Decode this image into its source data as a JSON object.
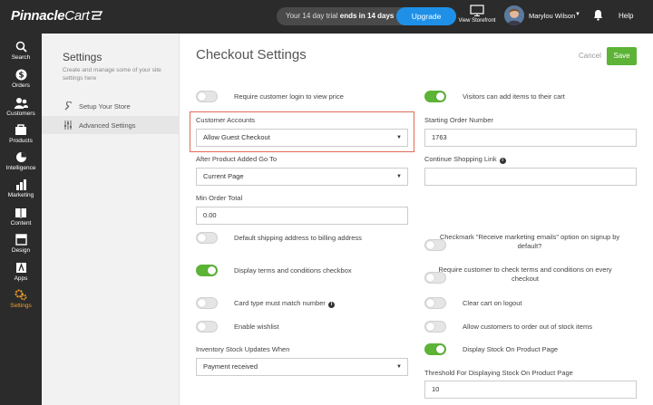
{
  "app": {
    "logo_main": "Pinnacle",
    "logo_cart": "Cart",
    "trial_prefix": "Your 14 day trial",
    "trial_bold": "ends in 14 days",
    "upgrade_label": "Upgrade",
    "storefront_label": "View Storefront",
    "user_name": "Marylou Wilson",
    "help_label": "Help"
  },
  "nav": [
    {
      "label": "Search",
      "icon": "search-icon"
    },
    {
      "label": "Orders",
      "icon": "dollar-icon"
    },
    {
      "label": "Customers",
      "icon": "users-icon"
    },
    {
      "label": "Products",
      "icon": "products-icon"
    },
    {
      "label": "Intelligence",
      "icon": "pie-chart-icon"
    },
    {
      "label": "Marketing",
      "icon": "bar-chart-icon"
    },
    {
      "label": "Content",
      "icon": "book-icon"
    },
    {
      "label": "Design",
      "icon": "design-icon"
    },
    {
      "label": "Apps",
      "icon": "apps-icon"
    },
    {
      "label": "Settings",
      "icon": "gear-icon",
      "active": true
    }
  ],
  "subpanel": {
    "title": "Settings",
    "description": "Create and manage some of your site settings here",
    "links": [
      "Setup Your Store",
      "Advanced Settings"
    ]
  },
  "page": {
    "title": "Checkout Settings",
    "cancel_label": "Cancel",
    "save_label": "Save"
  },
  "settings": {
    "require_login": {
      "label": "Require customer login to view price",
      "on": false
    },
    "visitors_add": {
      "label": "Visitors can add items to their cart",
      "on": true
    },
    "customer_accounts": {
      "label": "Customer Accounts",
      "value": "Allow Guest Checkout"
    },
    "starting_order": {
      "label": "Starting Order Number",
      "value": "1763"
    },
    "after_added": {
      "label": "After Product Added Go To",
      "value": "Current Page"
    },
    "continue_link": {
      "label": "Continue Shopping Link",
      "value": ""
    },
    "min_order": {
      "label": "Min Order Total",
      "value": "0.00"
    },
    "default_shipping": {
      "label": "Default shipping address to billing address",
      "on": false
    },
    "checkmark_marketing": {
      "label": "Checkmark \"Receive marketing emails\" option on signup by default?",
      "on": false
    },
    "display_terms": {
      "label": "Display terms and conditions checkbox",
      "on": true
    },
    "require_terms": {
      "label": "Require customer to check terms and conditions on every checkout",
      "on": false
    },
    "card_type": {
      "label": "Card type must match number",
      "on": false
    },
    "clear_cart": {
      "label": "Clear cart on logout",
      "on": false
    },
    "wishlist": {
      "label": "Enable wishlist",
      "on": false
    },
    "out_of_stock": {
      "label": "Allow customers to order out of stock items",
      "on": false
    },
    "inventory_updates": {
      "label": "Inventory Stock Updates When",
      "value": "Payment received"
    },
    "display_stock": {
      "label": "Display Stock On Product Page",
      "on": true
    },
    "stock_threshold": {
      "label": "Threshold For Displaying Stock On Product Page",
      "value": "10"
    }
  },
  "colors": {
    "accent_green": "#5cb336",
    "upgrade_blue": "#1e90e8",
    "highlight_red": "#e06b56",
    "active_nav": "#f0a030"
  }
}
